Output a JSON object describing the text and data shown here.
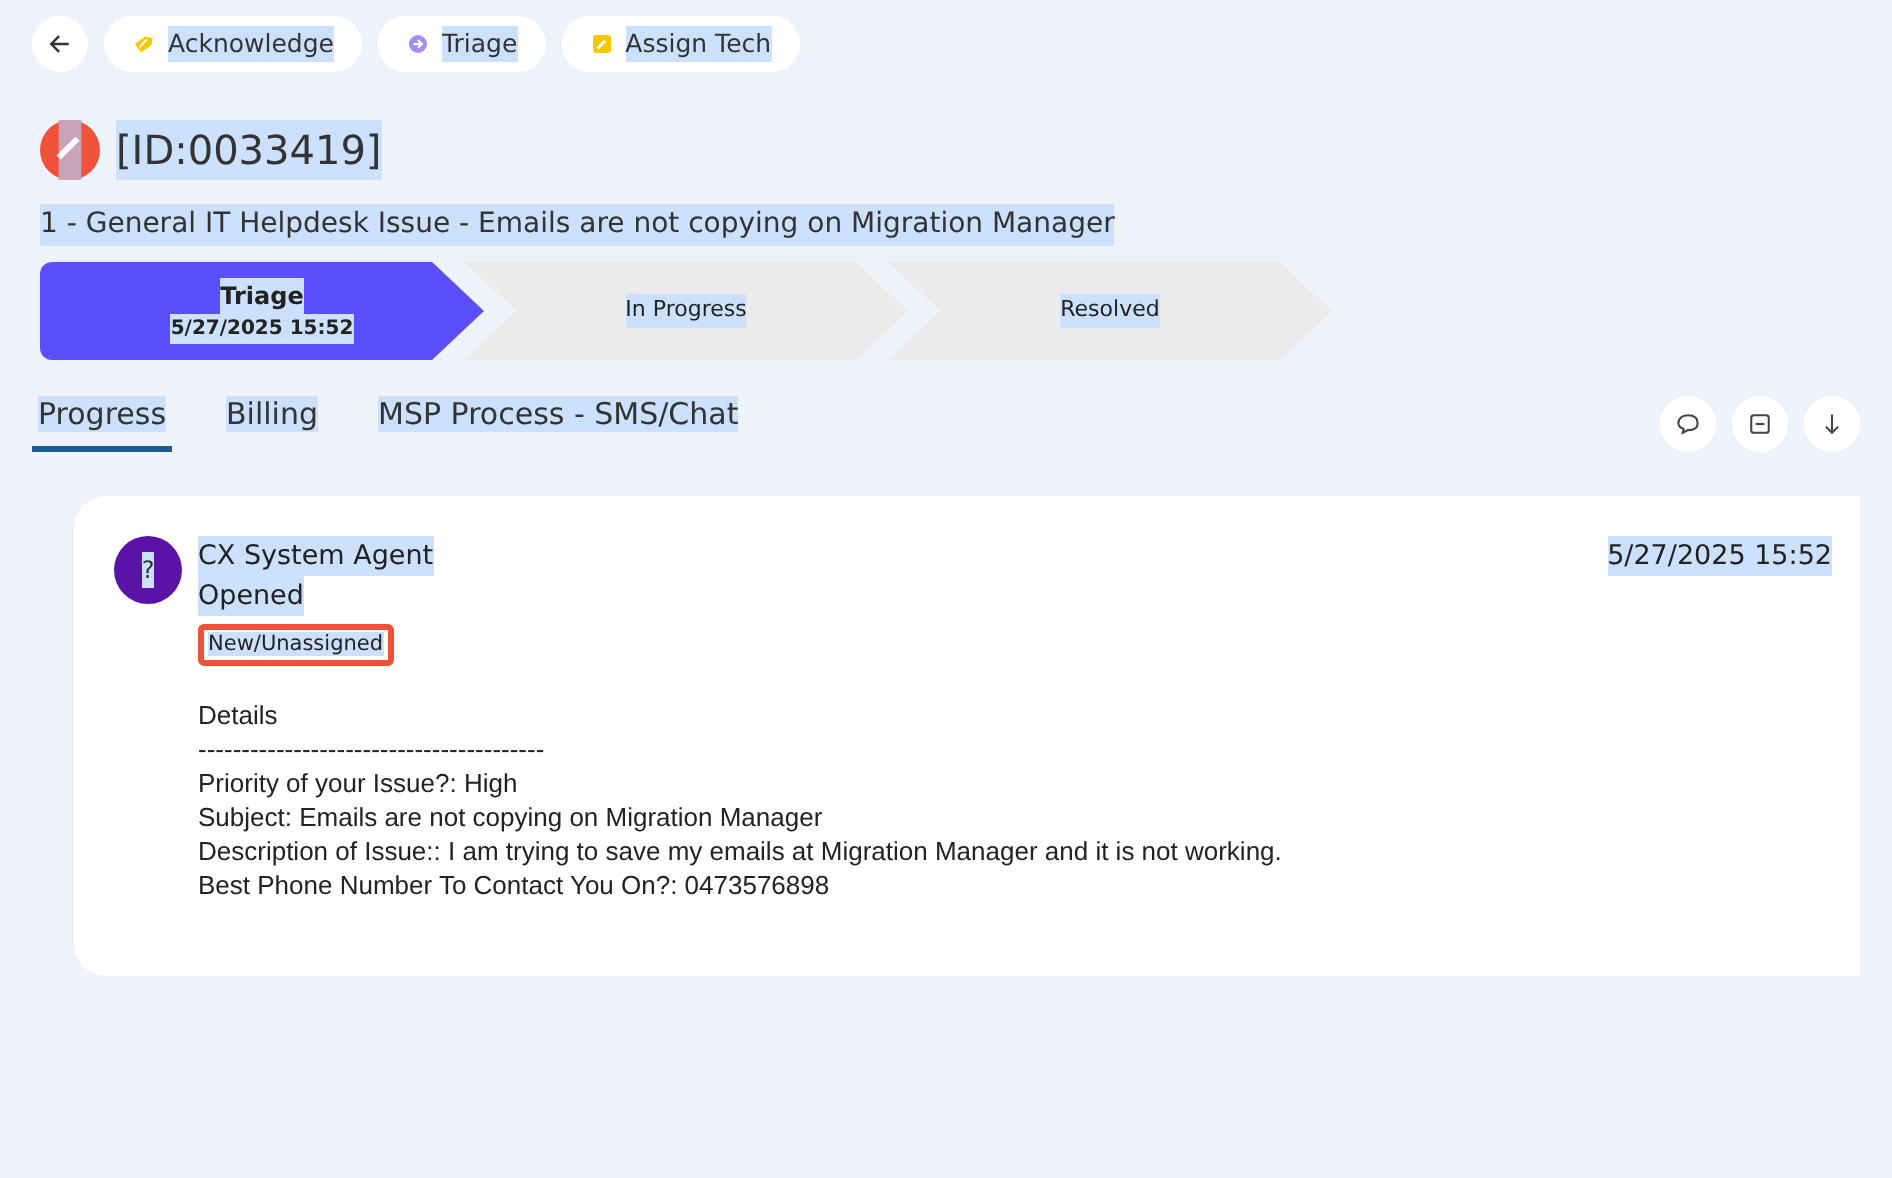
{
  "text_selected": true,
  "toolbar": {
    "back": true,
    "actions": [
      {
        "label": "Acknowledge",
        "kind": "acknowledge"
      },
      {
        "label": "Triage",
        "kind": "triage"
      },
      {
        "label": "Assign Tech",
        "kind": "assign"
      }
    ]
  },
  "ticket": {
    "id": "[ID:0033419]",
    "title": "1 - General IT Helpdesk Issue - Emails are not copying on Migration Manager"
  },
  "stages": [
    {
      "label": "Triage",
      "date": "5/27/2025 15:52",
      "selected": true
    },
    {
      "label": "In Progress",
      "selected": false
    },
    {
      "label": "Resolved",
      "selected": false
    }
  ],
  "tabs": [
    {
      "label": "Progress",
      "selected": true
    },
    {
      "label": "Billing",
      "selected": false
    },
    {
      "label": "MSP Process - SMS/Chat",
      "selected": false
    }
  ],
  "tab_actions": [
    {
      "kind": "comment"
    },
    {
      "kind": "collapse"
    },
    {
      "kind": "download"
    }
  ],
  "entry": {
    "avatar": "?",
    "author": "CX System Agent",
    "action": "Opened",
    "status_badge": "New/Unassigned",
    "time": "5/27/2025 15:52",
    "details": [
      "Details",
      "----------------------------------------",
      "Priority of your Issue?: High",
      "Subject: Emails are not copying on Migration Manager",
      "Description of Issue:: I am trying to save my emails at Migration Manager and it is not working.",
      "Best Phone Number To Contact You On?: 0473576898"
    ]
  }
}
